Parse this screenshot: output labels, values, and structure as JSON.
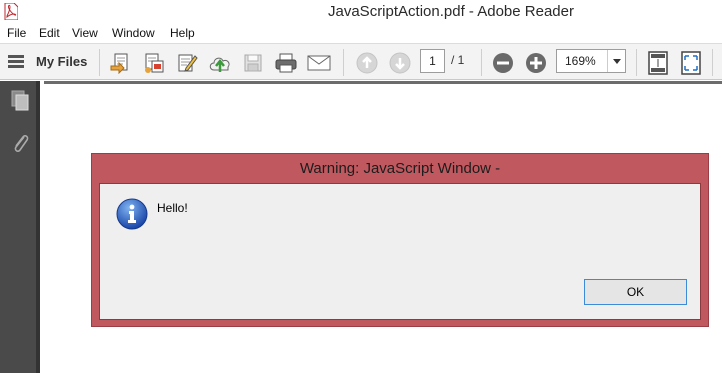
{
  "window": {
    "title": "JavaScriptAction.pdf - Adobe Reader"
  },
  "menu": {
    "items": [
      "File",
      "Edit",
      "View",
      "Window",
      "Help"
    ]
  },
  "toolbar": {
    "my_files_label": "My Files",
    "page_current": "1",
    "page_total": "/ 1",
    "zoom": "169%",
    "icons": [
      "open-icon",
      "create-pdf-icon",
      "edit-icon",
      "upload-cloud-icon",
      "save-icon",
      "print-icon",
      "email-icon",
      "previous-page-icon",
      "next-page-icon",
      "zoom-out-icon",
      "zoom-in-icon",
      "fit-page-icon",
      "full-screen-icon"
    ]
  },
  "left_panel": {
    "icons": [
      "pages-icon",
      "attachments-icon"
    ]
  },
  "dialog": {
    "title": "Warning: JavaScript Window -",
    "message": "Hello!",
    "ok_label": "OK",
    "icon": "info-icon",
    "frame_color": "#c0595f"
  }
}
